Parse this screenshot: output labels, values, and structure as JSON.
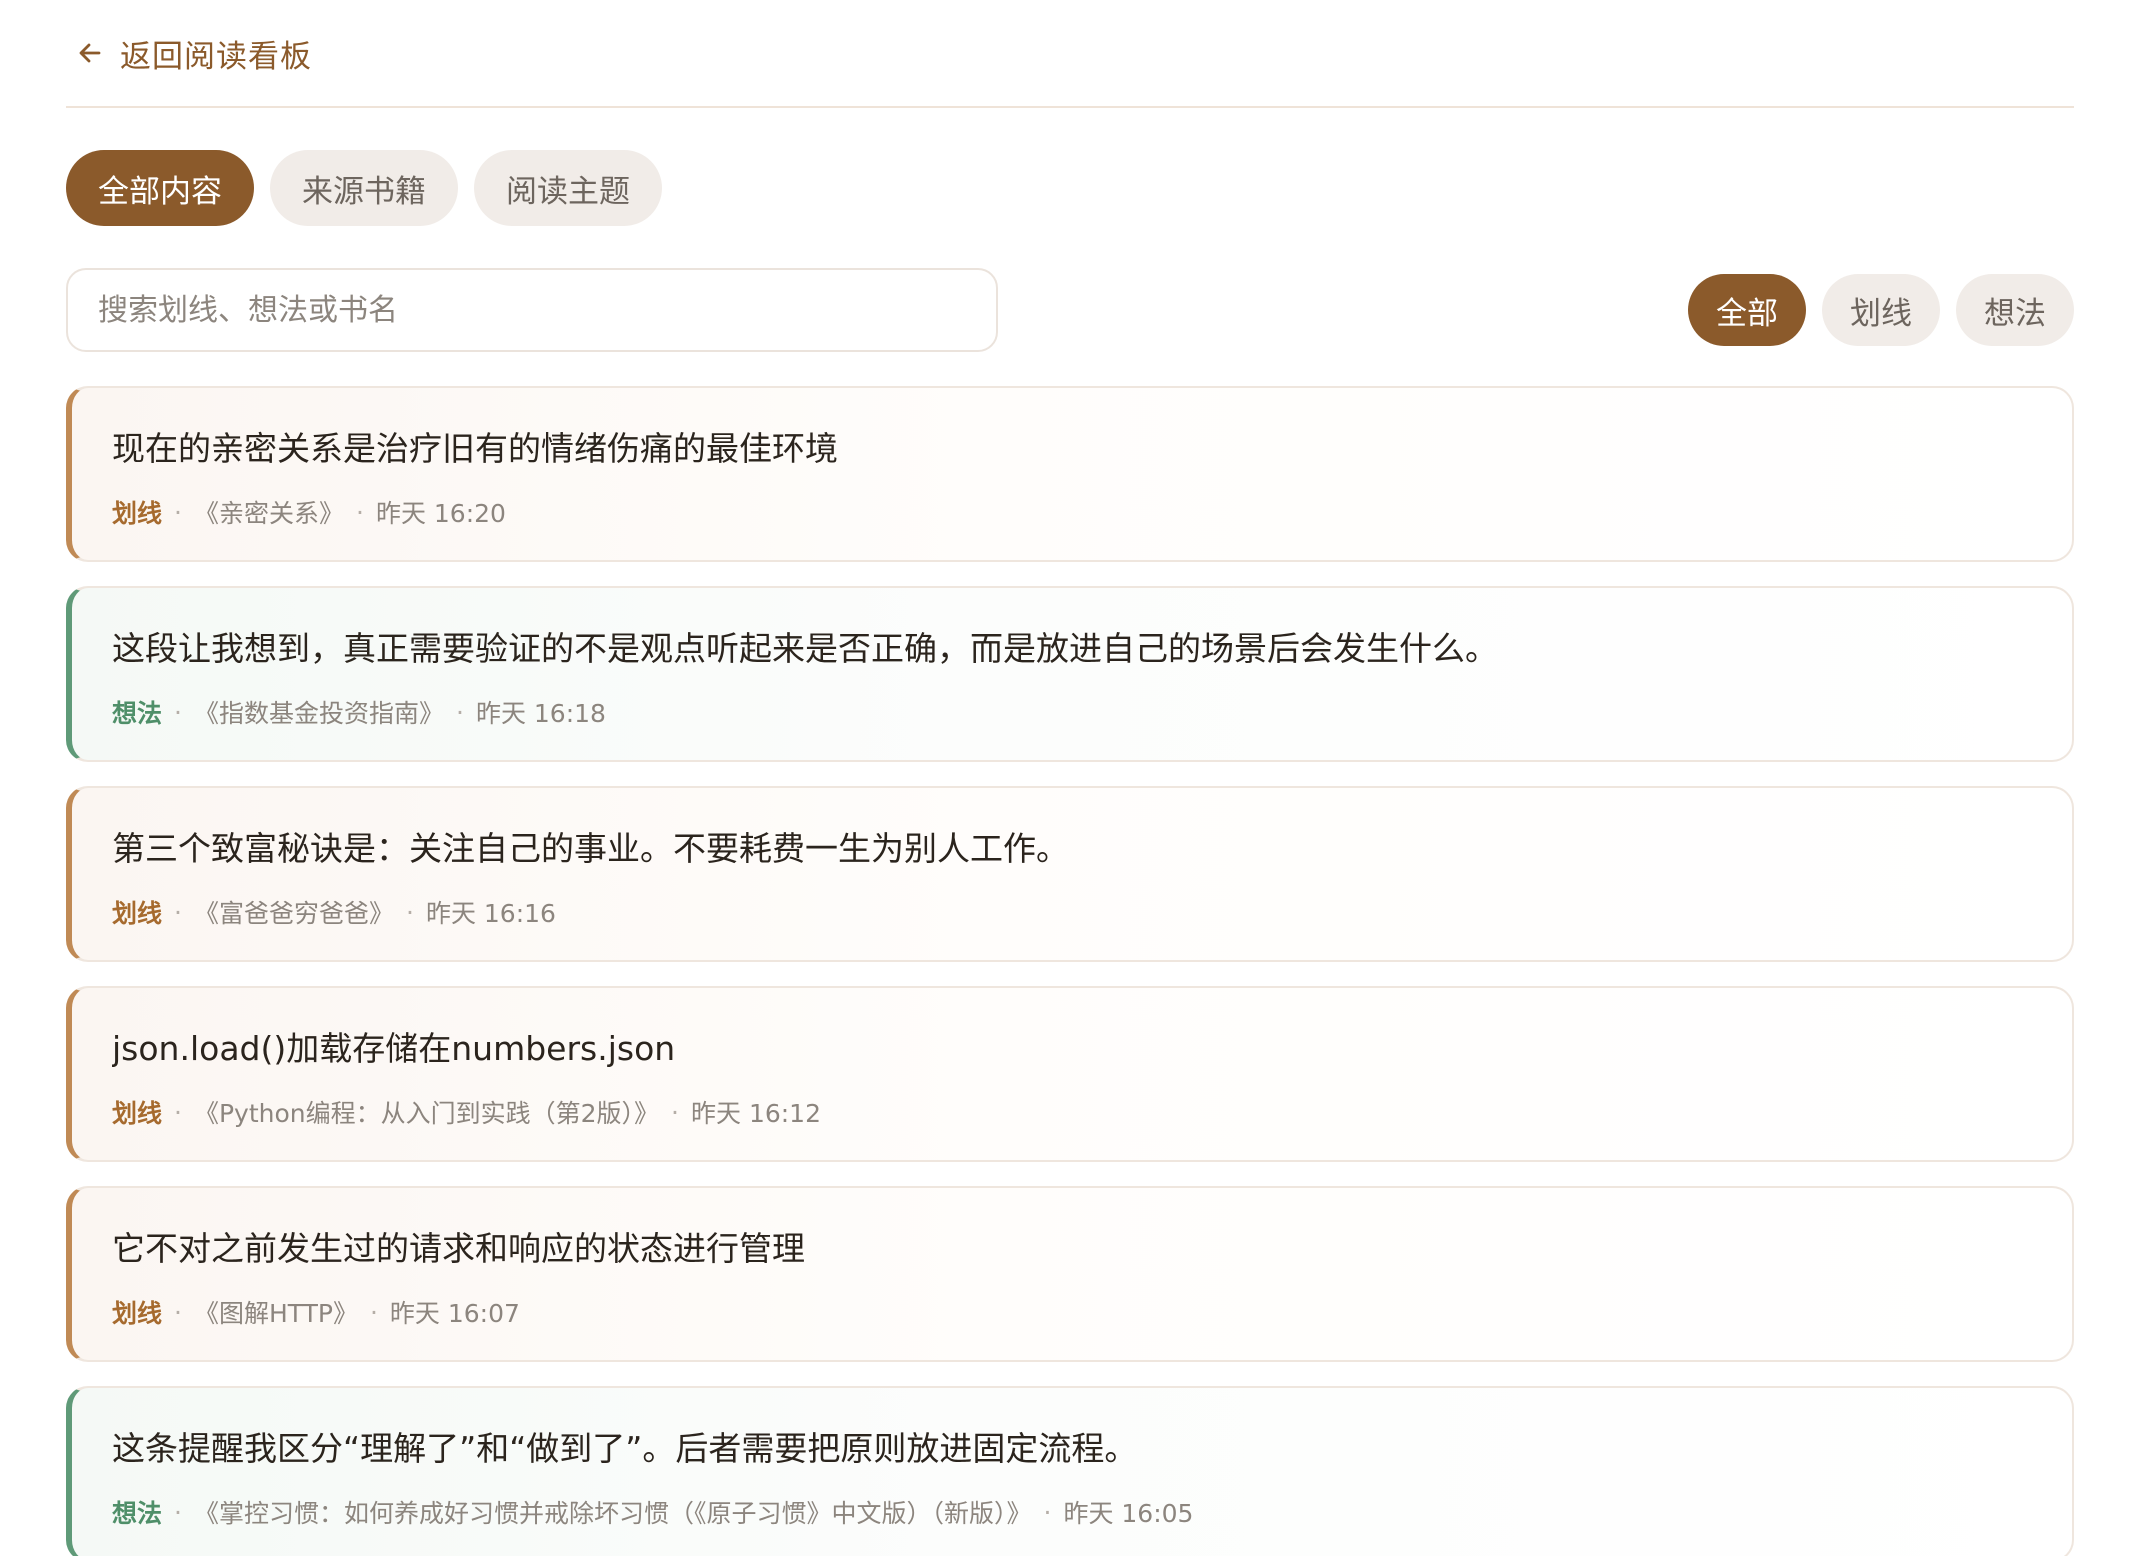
{
  "back": {
    "label": "返回阅读看板"
  },
  "tabs": [
    {
      "label": "全部内容",
      "active": true
    },
    {
      "label": "来源书籍",
      "active": false
    },
    {
      "label": "阅读主题",
      "active": false
    }
  ],
  "search": {
    "placeholder": "搜索划线、想法或书名",
    "value": ""
  },
  "filters": [
    {
      "label": "全部",
      "active": true
    },
    {
      "label": "划线",
      "active": false
    },
    {
      "label": "想法",
      "active": false
    }
  ],
  "items": [
    {
      "kind": "highlight",
      "text": "现在的亲密关系是治疗旧有的情绪伤痛的最佳环境",
      "type": "划线",
      "book": "《亲密关系》",
      "time": "昨天 16:20"
    },
    {
      "kind": "thought",
      "text": "这段让我想到，真正需要验证的不是观点听起来是否正确，而是放进自己的场景后会发生什么。",
      "type": "想法",
      "book": "《指数基金投资指南》",
      "time": "昨天 16:18"
    },
    {
      "kind": "highlight",
      "text": "第三个致富秘诀是：关注自己的事业。不要耗费一生为别人工作。",
      "type": "划线",
      "book": "《富爸爸穷爸爸》",
      "time": "昨天 16:16"
    },
    {
      "kind": "highlight",
      "text": "json.load()加载存储在numbers.json",
      "type": "划线",
      "book": "《Python编程：从入门到实践（第2版）》",
      "time": "昨天 16:12"
    },
    {
      "kind": "highlight",
      "text": "它不对之前发生过的请求和响应的状态进行管理",
      "type": "划线",
      "book": "《图解HTTP》",
      "time": "昨天 16:07"
    },
    {
      "kind": "thought",
      "text": "这条提醒我区分“理解了”和“做到了”。后者需要把原则放进固定流程。",
      "type": "想法",
      "book": "《掌控习惯：如何养成好习惯并戒除坏习惯（《原子习惯》中文版）（新版）》",
      "time": "昨天 16:05"
    }
  ],
  "colors": {
    "accent": "#8b5a2b",
    "highlight_bar": "#c08a55",
    "thought_bar": "#5f9a78"
  },
  "icons": {
    "back": "arrow-left-icon"
  }
}
